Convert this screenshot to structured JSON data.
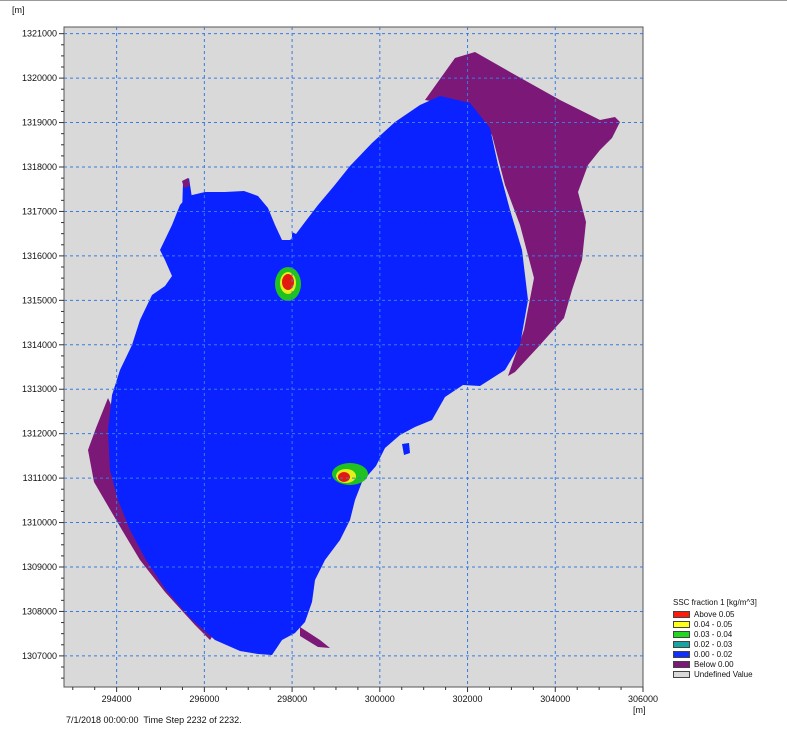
{
  "map": {
    "y_unit": "[m]",
    "x_unit": "[m]",
    "x_ticks": [
      "294000",
      "296000",
      "298000",
      "300000",
      "302000",
      "304000",
      "306000"
    ],
    "y_ticks": [
      "1307000",
      "1308000",
      "1309000",
      "1310000",
      "1311000",
      "1312000",
      "1313000",
      "1314000",
      "1315000",
      "1316000",
      "1317000",
      "1318000",
      "1319000",
      "1320000",
      "1321000"
    ],
    "x_range": [
      292800,
      306000
    ],
    "y_range": [
      1306300,
      1321150
    ],
    "grid": true,
    "colors": {
      "background": "#d9d9d9",
      "water": "#0a22ff",
      "low": "#7b1878",
      "hotspot_ring": "#1fc21f",
      "hotspot_mid": "#e6ef1a",
      "hotspot_core": "#e21a10",
      "grid": "#3a7be0"
    }
  },
  "legend": {
    "title": "SSC fraction 1 [kg/m^3]",
    "entries": [
      {
        "label": "Above 0.05",
        "color": "#ff1a10"
      },
      {
        "label": "0.04 - 0.05",
        "color": "#ffff1a"
      },
      {
        "label": "0.03 - 0.04",
        "color": "#1fd81f"
      },
      {
        "label": "0.02 - 0.03",
        "color": "#1aa3a3"
      },
      {
        "label": "0.00 - 0.02",
        "color": "#1030ff"
      },
      {
        "label": "Below  0.00",
        "color": "#7b1878"
      },
      {
        "label": "Undefined Value",
        "color": "#d9d9d9"
      }
    ]
  },
  "status": {
    "text": "7/1/2018 00:00:00  Time Step 2232 of 2232."
  }
}
